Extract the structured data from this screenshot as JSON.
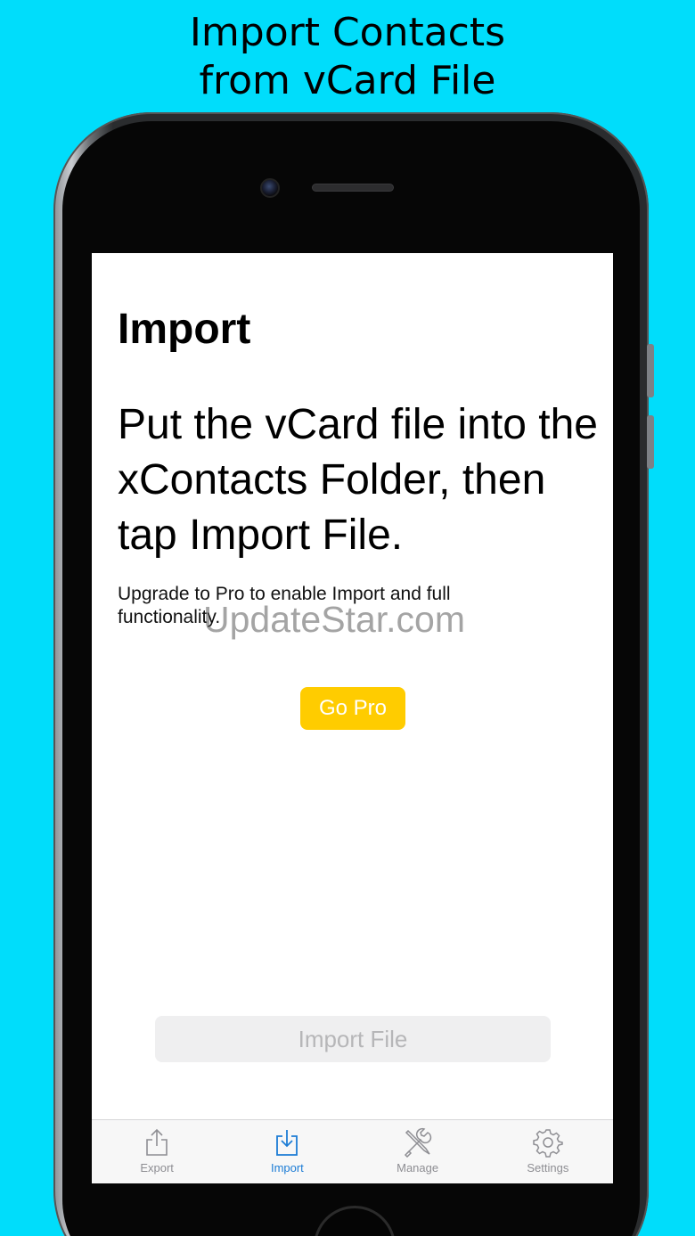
{
  "promo": {
    "line1": "Import Contacts",
    "line2": "from vCard File"
  },
  "screen": {
    "title": "Import",
    "headline": "Put the vCard file into the xContacts Folder, then tap Import File.",
    "note": "Upgrade to Pro to enable Import and full functionality.",
    "go_pro_label": "Go Pro",
    "import_file_label": "Import File",
    "watermark": "UpdateStar.com"
  },
  "tabbar": {
    "tabs": [
      {
        "label": "Export",
        "icon": "share-icon",
        "active": false
      },
      {
        "label": "Import",
        "icon": "download-icon",
        "active": true
      },
      {
        "label": "Manage",
        "icon": "tools-icon",
        "active": false
      },
      {
        "label": "Settings",
        "icon": "gear-icon",
        "active": false
      }
    ]
  },
  "colors": {
    "background": "#00DDFB",
    "go_pro": "#FFCC00",
    "active_tab": "#1C7CD5",
    "inactive_tab": "#8E8E93",
    "disabled_button_bg": "#EFEFF0",
    "disabled_button_text": "#B6B6B8"
  }
}
